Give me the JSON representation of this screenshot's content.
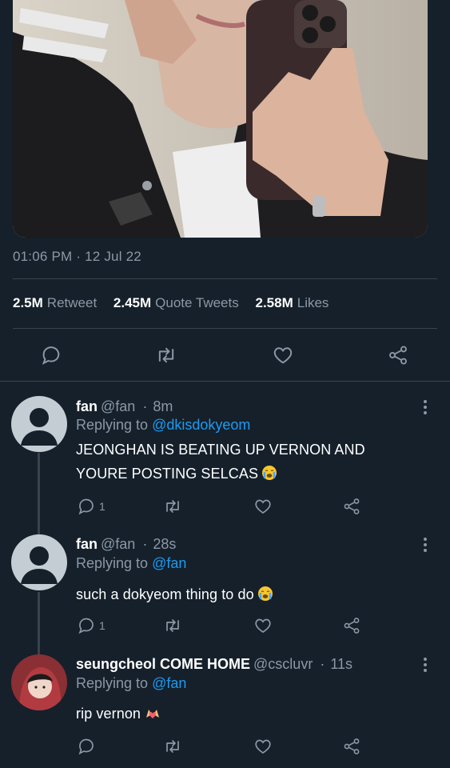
{
  "tweet": {
    "time": "01:06 PM",
    "date": "12 Jul 22",
    "stats": {
      "retweets_count": "2.5M",
      "retweets_label": "Retweet",
      "quotes_count": "2.45M",
      "quotes_label": "Quote Tweets",
      "likes_count": "2.58M",
      "likes_label": "Likes"
    }
  },
  "icons": {
    "reply": "speech-bubble-icon",
    "retweet": "retweet-arrows-icon",
    "like": "heart-outline-icon",
    "share": "share-nodes-icon",
    "more": "vertical-ellipsis-icon"
  },
  "colors": {
    "background": "#15202b",
    "muted": "#8b98a5",
    "link": "#1d9bf0",
    "divider": "#38444d"
  },
  "replies": [
    {
      "name": "fan",
      "handle": "@fan",
      "sep": "·",
      "time": "8m",
      "replying_label": "Replying to",
      "replying_to": "@dkisdokyeom",
      "text": "JEONGHAN IS BEATING UP VERNON AND YOURE POSTING SELCAS",
      "emoji": "crying-face",
      "reply_count": "1"
    },
    {
      "name": "fan",
      "handle": "@fan",
      "sep": "·",
      "time": "28s",
      "replying_label": "Replying to",
      "replying_to": "@fan",
      "text": "such a dokyeom thing to do",
      "emoji": "crying-face",
      "reply_count": "1"
    },
    {
      "name": "seungcheol COME HOME",
      "handle": "@cscluvr",
      "sep": "·",
      "time": "11s",
      "replying_label": "Replying to",
      "replying_to": "@fan",
      "text": "rip vernon",
      "emoji": "heart-hands",
      "reply_count": ""
    }
  ]
}
